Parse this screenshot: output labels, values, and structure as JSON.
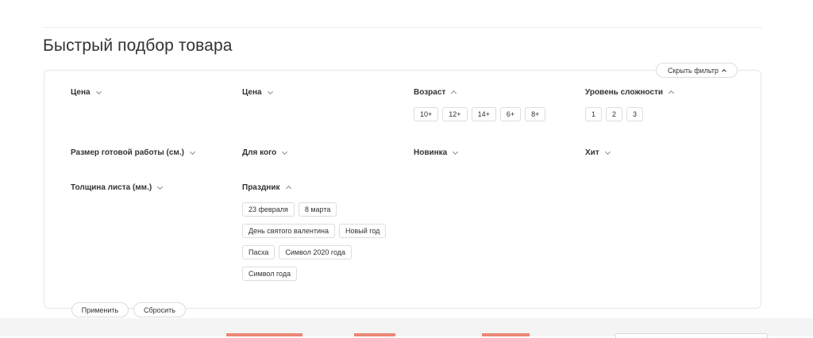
{
  "page": {
    "title": "Быстрый подбор товара"
  },
  "filter": {
    "toggle_label": "Скрыть фильтр",
    "groups": {
      "price1": {
        "label": "Цена"
      },
      "price2": {
        "label": "Цена"
      },
      "age": {
        "label": "Возраст",
        "options": [
          "10+",
          "12+",
          "14+",
          "6+",
          "8+"
        ]
      },
      "difficulty": {
        "label": "Уровень сложности",
        "options": [
          "1",
          "2",
          "3"
        ]
      },
      "size": {
        "label": "Размер готовой работы (см.)"
      },
      "for_whom": {
        "label": "Для кого"
      },
      "new": {
        "label": "Новинка"
      },
      "hit": {
        "label": "Хит"
      },
      "thickness": {
        "label": "Толщина листа (мм.)"
      },
      "holiday": {
        "label": "Праздник",
        "options": [
          "23 февраля",
          "8 марта",
          "День святого валентина",
          "Новый год",
          "Пасха",
          "Символ 2020 года",
          "Символ года"
        ]
      }
    },
    "apply_label": "Применить",
    "reset_label": "Сбросить"
  },
  "colors": {
    "accent": "#e8634a",
    "border": "#dddddd",
    "footer_bg": "#f4f4f4"
  }
}
